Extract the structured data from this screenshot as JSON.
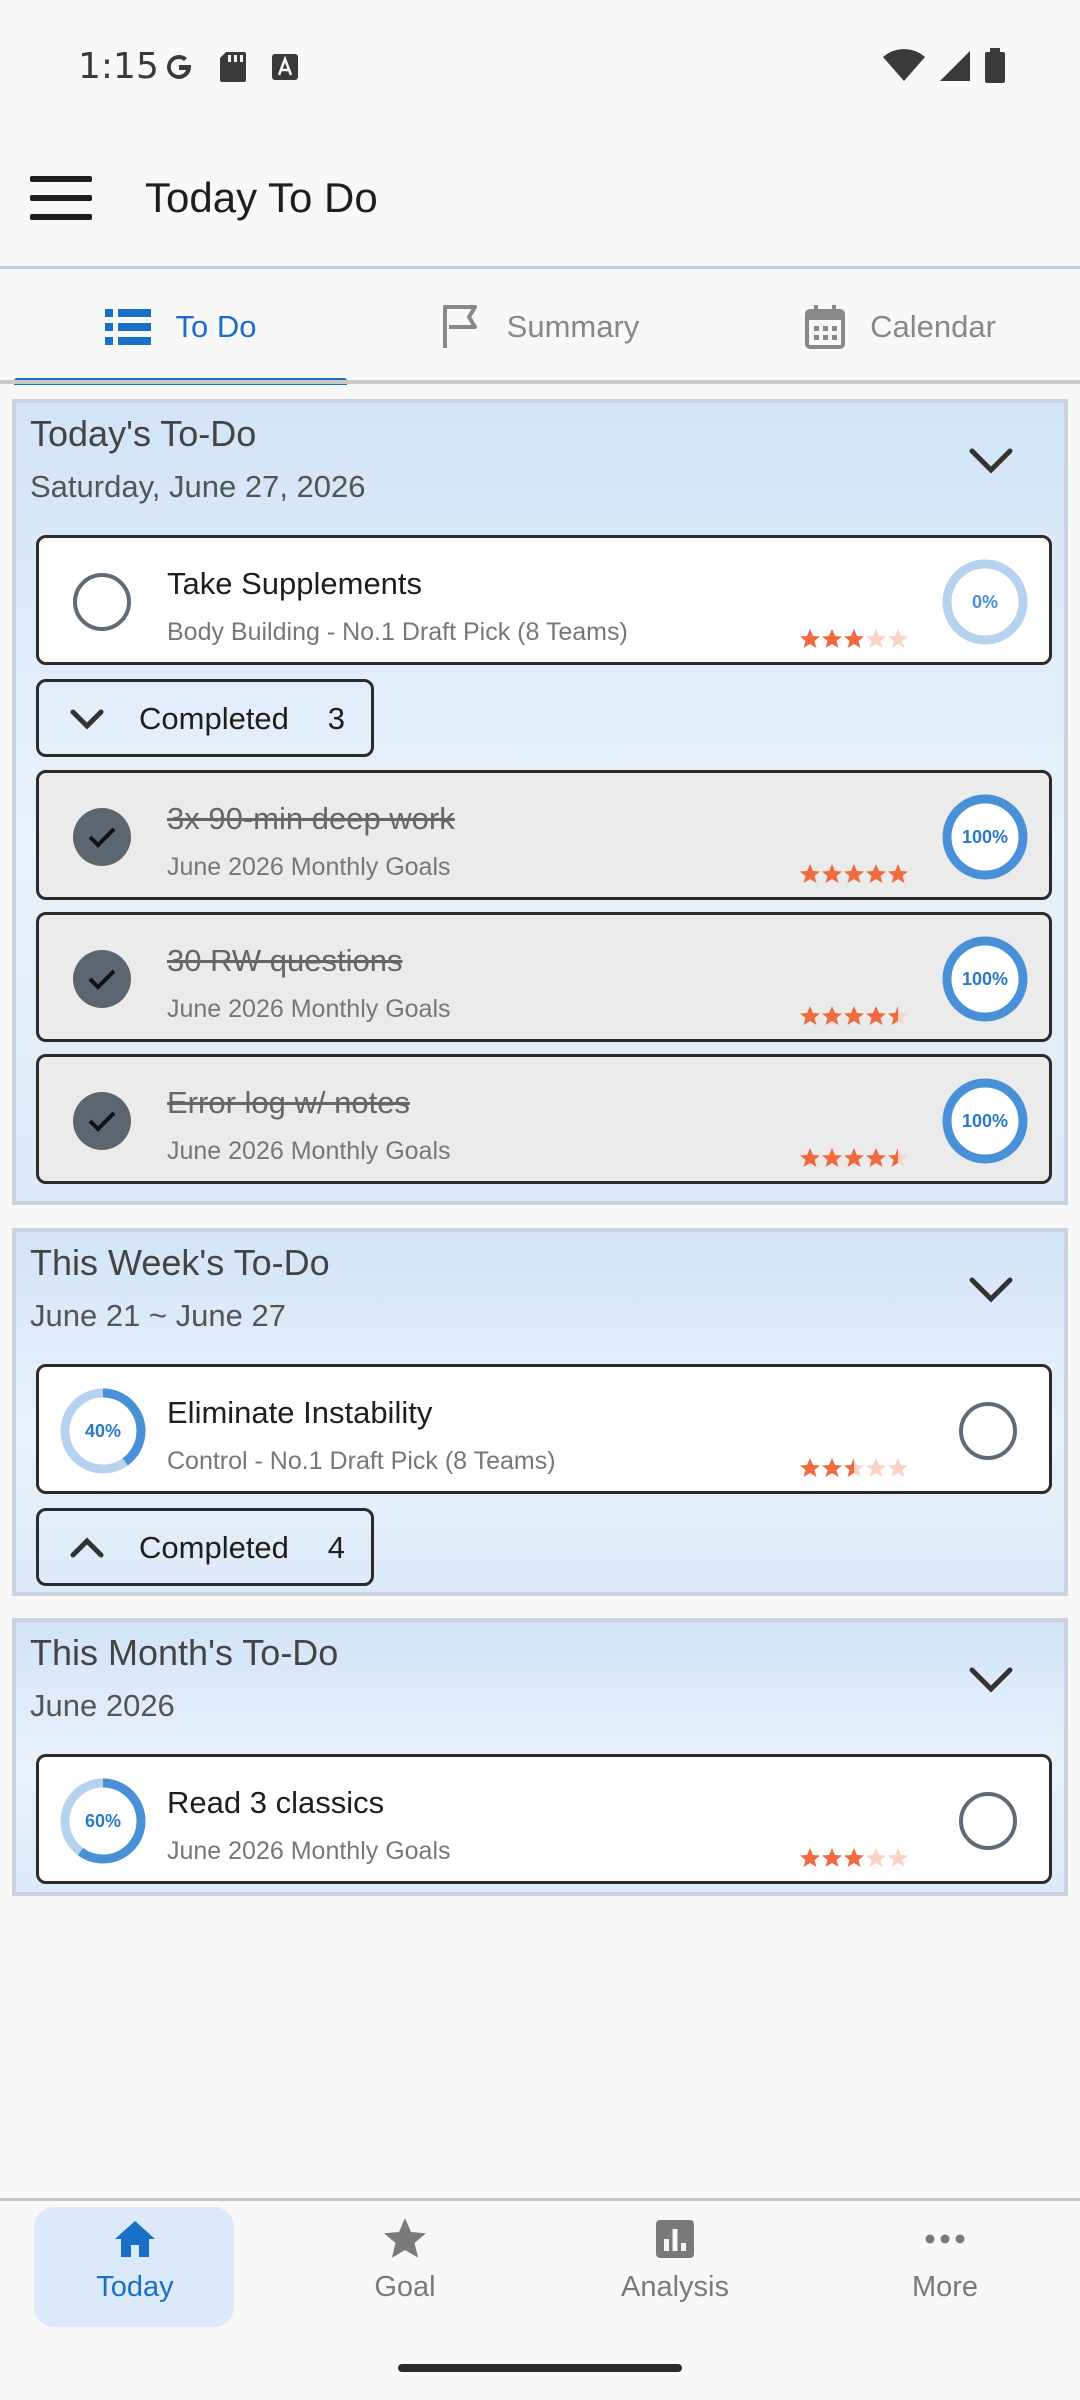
{
  "status_bar": {
    "time": "1:15"
  },
  "app_bar": {
    "title": "Today To Do"
  },
  "tabs": [
    {
      "label": "To Do",
      "active": true,
      "icon": "list-icon"
    },
    {
      "label": "Summary",
      "active": false,
      "icon": "flag-icon"
    },
    {
      "label": "Calendar",
      "active": false,
      "icon": "calendar-icon"
    }
  ],
  "colors": {
    "accent": "#1a6fc7",
    "ring": "#4a90d9",
    "ring_track": "#b7d2ee",
    "star": "#f06a3f"
  },
  "today": {
    "title": "Today's To-Do",
    "date": "Saturday, June 27, 2026",
    "items": [
      {
        "title": "Take Supplements",
        "subtitle": "Body Building - No.1 Draft Pick (8 Teams)",
        "progress": "0%",
        "rating": 3
      }
    ],
    "completed_label": "Completed",
    "completed_count": "3",
    "completed_items": [
      {
        "title": "3x 90-min deep work",
        "subtitle": "June 2026 Monthly Goals",
        "progress": "100%",
        "rating": 5
      },
      {
        "title": "30 RW questions",
        "subtitle": "June 2026 Monthly Goals",
        "progress": "100%",
        "rating": 4.5
      },
      {
        "title": "Error log w/ notes",
        "subtitle": "June 2026 Monthly Goals",
        "progress": "100%",
        "rating": 4.5
      }
    ]
  },
  "week": {
    "title": "This Week's To-Do",
    "date": "June 21 ~ June 27",
    "items": [
      {
        "title": "Eliminate Instability",
        "subtitle": "Control - No.1 Draft Pick (8 Teams)",
        "progress": "40%",
        "rating": 2.5
      }
    ],
    "completed_label": "Completed",
    "completed_count": "4"
  },
  "month": {
    "title": "This Month's To-Do",
    "date": "June 2026",
    "items": [
      {
        "title": "Read 3 classics",
        "subtitle": "June 2026 Monthly Goals",
        "progress": "60%",
        "rating": 3
      }
    ]
  },
  "bottom_nav": [
    {
      "label": "Today",
      "active": true,
      "icon": "home-icon"
    },
    {
      "label": "Goal",
      "active": false,
      "icon": "star-icon"
    },
    {
      "label": "Analysis",
      "active": false,
      "icon": "bar-chart-icon"
    },
    {
      "label": "More",
      "active": false,
      "icon": "more-icon"
    }
  ]
}
